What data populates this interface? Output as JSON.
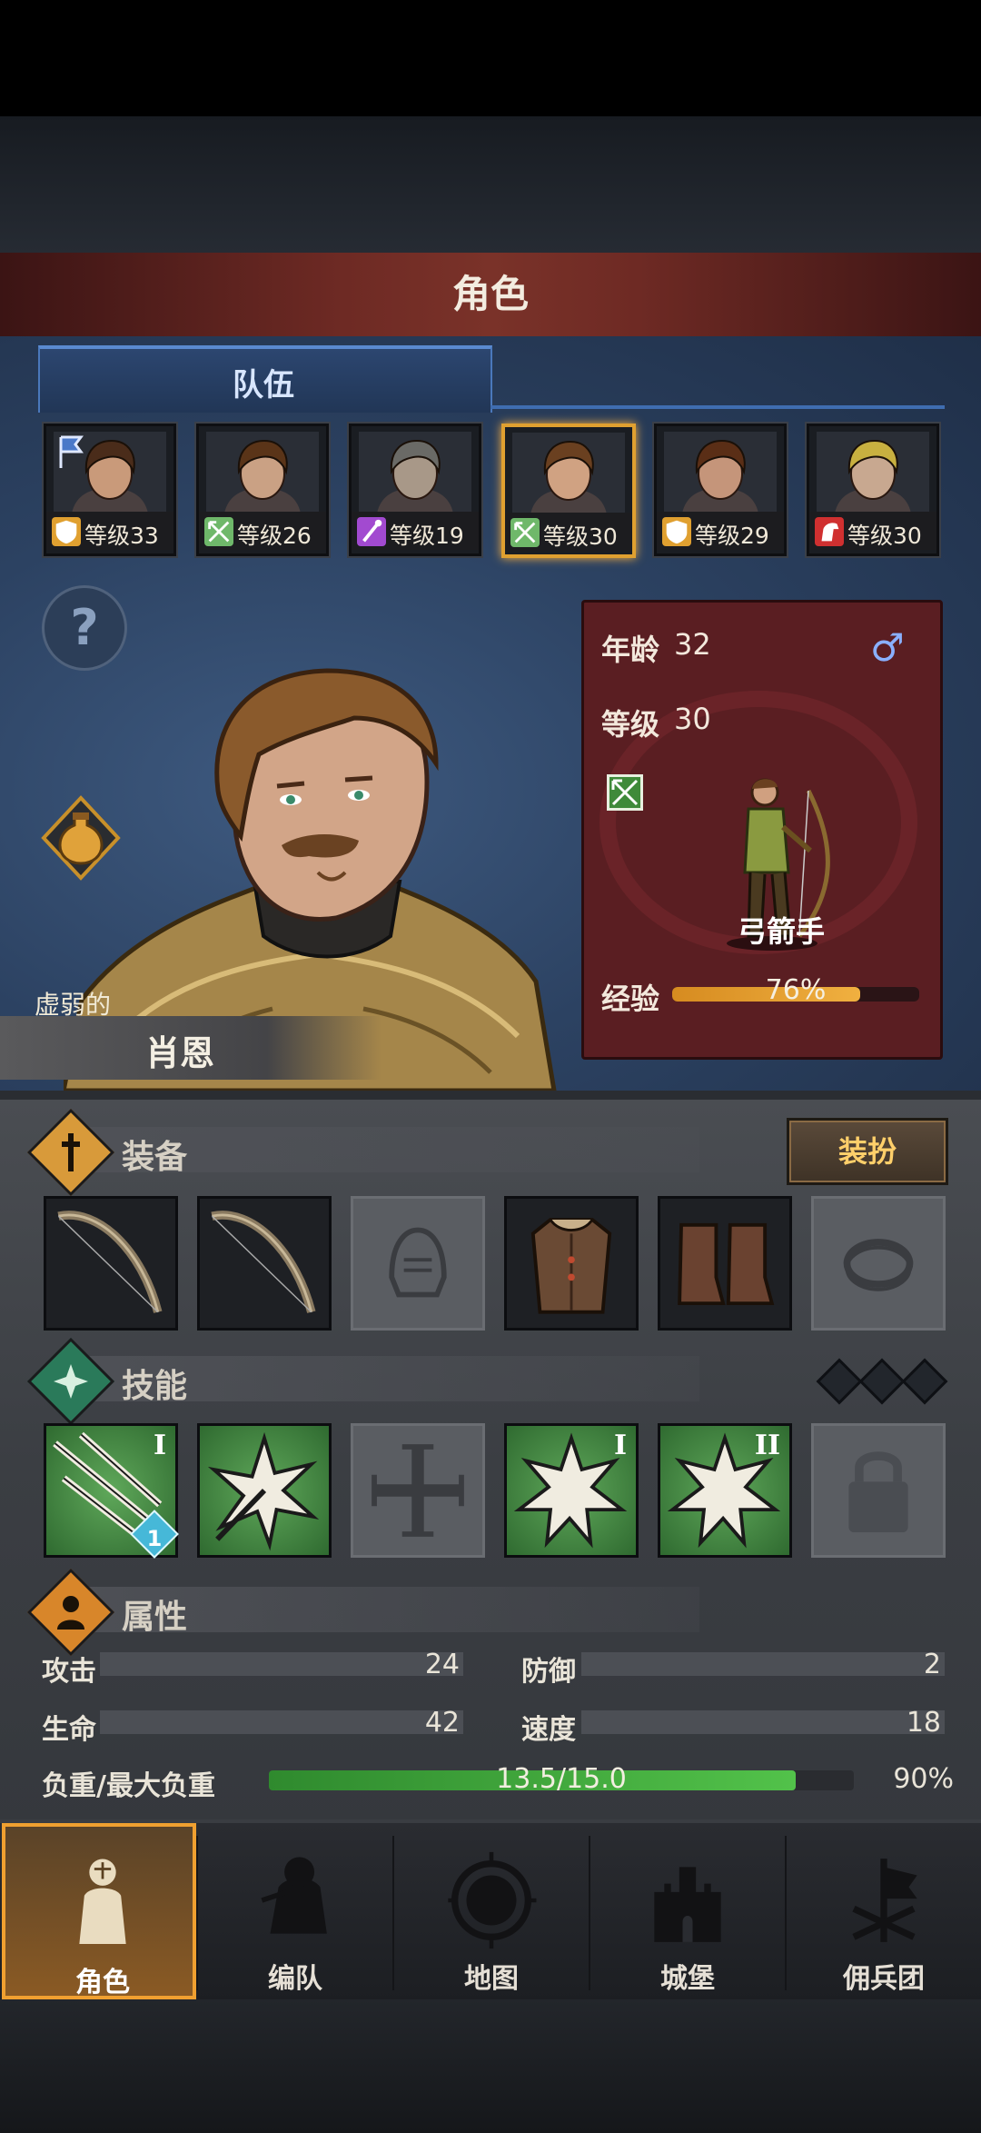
{
  "header": {
    "title": "角色"
  },
  "tabs": {
    "team": "队伍"
  },
  "party": [
    {
      "level": "等级33",
      "class_icon": "shield-icon",
      "class_color": "#e0a030",
      "flag": true,
      "hair": "#4a2c1a",
      "skin": "#c99a7a",
      "selected": false
    },
    {
      "level": "等级26",
      "class_icon": "bow-icon",
      "class_color": "#6fb86a",
      "flag": false,
      "hair": "#5a3418",
      "skin": "#caa184",
      "selected": false
    },
    {
      "level": "等级19",
      "class_icon": "staff-icon",
      "class_color": "#a24ad0",
      "flag": false,
      "hair": "#6a6a66",
      "skin": "#a89888",
      "selected": false
    },
    {
      "level": "等级30",
      "class_icon": "bow-icon",
      "class_color": "#6fb86a",
      "flag": false,
      "hair": "#6a4020",
      "skin": "#d0a282",
      "selected": true
    },
    {
      "level": "等级29",
      "class_icon": "shield-icon",
      "class_color": "#e0a030",
      "flag": false,
      "hair": "#5a2e16",
      "skin": "#c5957a",
      "selected": false
    },
    {
      "level": "等级30",
      "class_icon": "horse-icon",
      "class_color": "#d03030",
      "flag": false,
      "hair": "#c8b040",
      "skin": "#c8a890",
      "selected": false
    }
  ],
  "hero": {
    "trait": "虚弱的",
    "name": "肖恩",
    "age_label": "年龄",
    "age": "32",
    "level_label": "等级",
    "level": "30",
    "class_name": "弓箭手",
    "exp_label": "经验",
    "exp_percent": 76,
    "exp_text": "76%"
  },
  "equipment": {
    "title": "装备",
    "dress_button": "装扮",
    "slots": [
      {
        "type": "bow",
        "empty": false
      },
      {
        "type": "bow",
        "empty": false
      },
      {
        "type": "helmet",
        "empty": true
      },
      {
        "type": "armor",
        "empty": false
      },
      {
        "type": "boots",
        "empty": false
      },
      {
        "type": "ring",
        "empty": true
      }
    ]
  },
  "skills": {
    "title": "技能",
    "slots": [
      {
        "type": "arrow-volley",
        "roman": "I",
        "badge": "1",
        "empty": false,
        "locked": false
      },
      {
        "type": "arrow-burst",
        "roman": "",
        "badge": "",
        "empty": false,
        "locked": false
      },
      {
        "type": "cross",
        "roman": "",
        "badge": "",
        "empty": true,
        "locked": false
      },
      {
        "type": "burst",
        "roman": "I",
        "badge": "",
        "empty": false,
        "locked": false
      },
      {
        "type": "burst",
        "roman": "II",
        "badge": "",
        "empty": false,
        "locked": false
      },
      {
        "type": "lock",
        "roman": "",
        "badge": "",
        "empty": true,
        "locked": true
      }
    ]
  },
  "attributes": {
    "title": "属性",
    "attack_label": "攻击",
    "attack": "24",
    "defense_label": "防御",
    "defense": "2",
    "hp_label": "生命",
    "hp": "42",
    "speed_label": "速度",
    "speed": "18",
    "load_label": "负重/最大负重",
    "load_text": "13.5/15.0",
    "load_percent": 90,
    "load_pct_text": "90%"
  },
  "nav": [
    {
      "label": "角色",
      "icon": "knight-icon",
      "active": true
    },
    {
      "label": "编队",
      "icon": "formation-icon",
      "active": false
    },
    {
      "label": "地图",
      "icon": "compass-map-icon",
      "active": false
    },
    {
      "label": "城堡",
      "icon": "castle-icon",
      "active": false
    },
    {
      "label": "佣兵团",
      "icon": "mercenary-banner-icon",
      "active": false
    }
  ]
}
